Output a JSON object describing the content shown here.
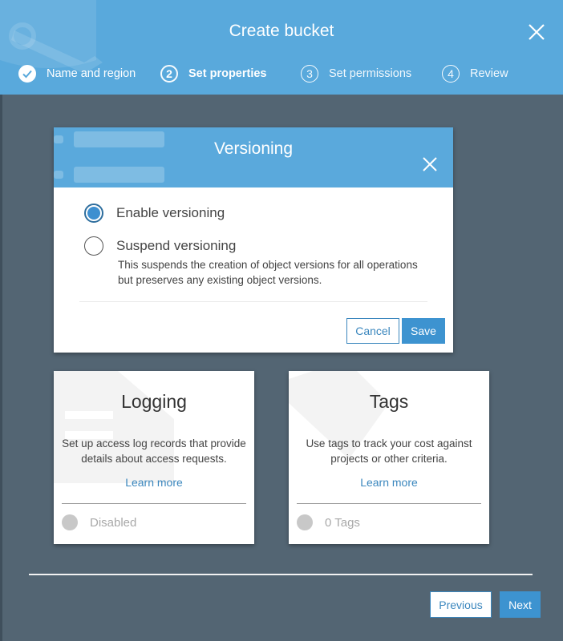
{
  "header": {
    "title": "Create bucket",
    "steps": [
      {
        "number": "1",
        "label": "Name and region",
        "state": "completed"
      },
      {
        "number": "2",
        "label": "Set properties",
        "state": "current"
      },
      {
        "number": "3",
        "label": "Set permissions",
        "state": "pending"
      },
      {
        "number": "4",
        "label": "Review",
        "state": "pending"
      }
    ]
  },
  "versioning": {
    "title": "Versioning",
    "options": [
      {
        "label": "Enable versioning",
        "checked": true
      },
      {
        "label": "Suspend versioning",
        "checked": false
      }
    ],
    "suspend_description": "This suspends the creation of object versions for all operations but preserves any existing object versions.",
    "cancel_label": "Cancel",
    "save_label": "Save"
  },
  "logging": {
    "title": "Logging",
    "description": "Set up access log records that provide details about access requests.",
    "link": "Learn more",
    "status": "Disabled"
  },
  "tags": {
    "title": "Tags",
    "description": "Use tags to track your cost against projects or other criteria.",
    "link": "Learn more",
    "status": "0 Tags"
  },
  "footer": {
    "previous_label": "Previous",
    "next_label": "Next"
  },
  "colors": {
    "header": "#59a9dc",
    "background": "#536573",
    "accent": "#3d93d0",
    "link": "#3b87be"
  }
}
